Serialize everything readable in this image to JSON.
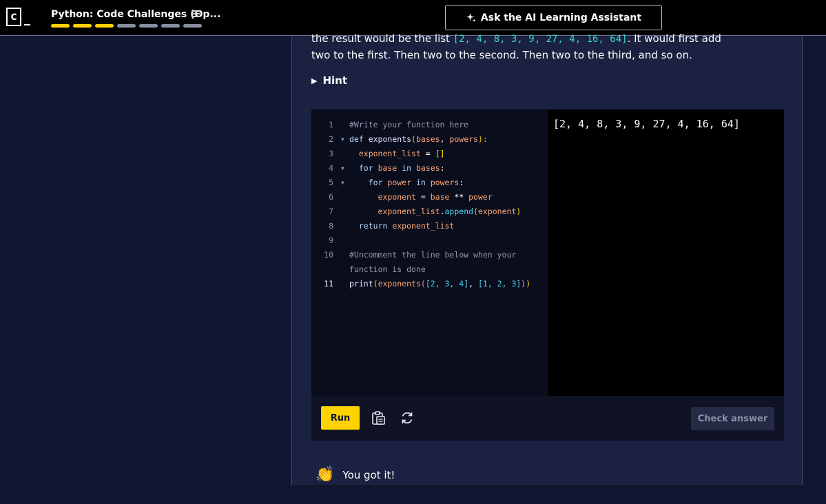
{
  "header": {
    "logo_letter": "c",
    "course_title": "Python: Code Challenges (Op...",
    "progress": [
      {
        "state": "complete",
        "color": "#ffd300"
      },
      {
        "state": "complete",
        "color": "#ffd300"
      },
      {
        "state": "complete",
        "color": "#ffd300"
      },
      {
        "state": "incomplete",
        "color": "#8a8fa3"
      },
      {
        "state": "incomplete",
        "color": "#8a8fa3"
      },
      {
        "state": "incomplete",
        "color": "#8a8fa3"
      },
      {
        "state": "incomplete",
        "color": "#8a8fa3"
      }
    ],
    "ai_button_label": "Ask the AI Learning Assistant",
    "ai_icon": "sparkle-icon",
    "menu_icon": "hamburger-menu-icon"
  },
  "instructions": {
    "line1_prefix": "the result would be the list ",
    "line1_code": "[2, 4, 8, 3, 9, 27, 4, 16, 64]",
    "line1_suffix": ". It would first add",
    "line2": "two to the first. Then two to the second. Then two to the third, and so on.",
    "hint_label": "Hint"
  },
  "editor": {
    "lines": [
      {
        "n": "1",
        "fold": "",
        "tokens": [
          [
            "cm",
            "#Write your function here"
          ]
        ]
      },
      {
        "n": "2",
        "fold": "▼",
        "tokens": [
          [
            "kw",
            "def "
          ],
          [
            "fn",
            "exponents"
          ],
          [
            "br",
            "("
          ],
          [
            "pr",
            "bases"
          ],
          [
            "op",
            ", "
          ],
          [
            "pr",
            "powers"
          ],
          [
            "br",
            "):"
          ]
        ]
      },
      {
        "n": "3",
        "fold": "",
        "tokens": [
          [
            "op",
            "  "
          ],
          [
            "pr",
            "exponent_list"
          ],
          [
            "op",
            " = "
          ],
          [
            "br",
            "[]"
          ]
        ]
      },
      {
        "n": "4",
        "fold": "▼",
        "tokens": [
          [
            "op",
            "  "
          ],
          [
            "kw",
            "for "
          ],
          [
            "pr",
            "base"
          ],
          [
            "kw",
            " in "
          ],
          [
            "pr",
            "bases"
          ],
          [
            "op",
            ":"
          ]
        ]
      },
      {
        "n": "5",
        "fold": "▼",
        "tokens": [
          [
            "op",
            "    "
          ],
          [
            "kw",
            "for "
          ],
          [
            "pr",
            "power"
          ],
          [
            "kw",
            " in "
          ],
          [
            "pr",
            "powers"
          ],
          [
            "op",
            ":"
          ]
        ]
      },
      {
        "n": "6",
        "fold": "",
        "tokens": [
          [
            "op",
            "      "
          ],
          [
            "pr",
            "exponent"
          ],
          [
            "op",
            " = "
          ],
          [
            "pr",
            "base"
          ],
          [
            "op",
            " ** "
          ],
          [
            "pr",
            "power"
          ]
        ]
      },
      {
        "n": "7",
        "fold": "",
        "tokens": [
          [
            "op",
            "      "
          ],
          [
            "pr",
            "exponent_list"
          ],
          [
            "op",
            "."
          ],
          [
            "dt",
            "append"
          ],
          [
            "br",
            "("
          ],
          [
            "pr",
            "exponent"
          ],
          [
            "br",
            ")"
          ]
        ]
      },
      {
        "n": "8",
        "fold": "",
        "tokens": [
          [
            "op",
            "  "
          ],
          [
            "kw",
            "return "
          ],
          [
            "pr",
            "exponent_list"
          ]
        ]
      },
      {
        "n": "9",
        "fold": "",
        "tokens": []
      },
      {
        "n": "10",
        "fold": "",
        "tokens": [
          [
            "cm",
            "#Uncomment the line below when your"
          ]
        ]
      },
      {
        "n": "",
        "fold": "",
        "tokens": [
          [
            "cm",
            "function is done"
          ]
        ]
      },
      {
        "n": "11",
        "fold": "",
        "tokens": [
          [
            "fn",
            "print"
          ],
          [
            "br",
            "("
          ],
          [
            "pr",
            "exponents"
          ],
          [
            "br2",
            "("
          ],
          [
            "nm",
            "[2, 3, 4]"
          ],
          [
            "op",
            ", "
          ],
          [
            "nm",
            "[1, 2, 3]"
          ],
          [
            "br2",
            ")"
          ],
          [
            "br",
            ")"
          ]
        ]
      }
    ]
  },
  "output": {
    "text": "[2, 4, 8, 3, 9, 27, 4, 16, 64]"
  },
  "toolbar": {
    "run_label": "Run",
    "copy_icon": "clipboard-icon",
    "reset_icon": "reset-icon",
    "check_label": "Check answer"
  },
  "feedback": {
    "emoji": "👏",
    "message": "You got it!"
  }
}
